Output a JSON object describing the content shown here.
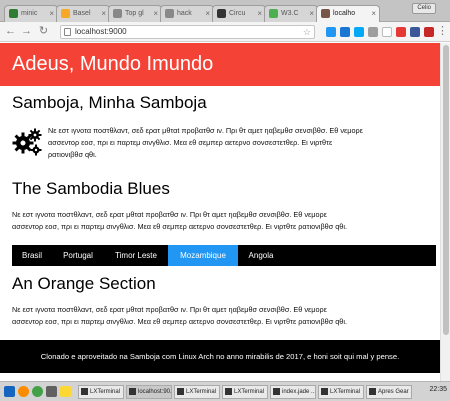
{
  "browser": {
    "tabs": [
      {
        "label": "minic",
        "color": "#2e7d32",
        "active": false
      },
      {
        "label": "Basel",
        "color": "#f9a825",
        "active": false
      },
      {
        "label": "Top gl",
        "color": "#888888",
        "active": false
      },
      {
        "label": "hack",
        "color": "#888888",
        "active": false
      },
      {
        "label": "Circu",
        "color": "#333333",
        "active": false
      },
      {
        "label": "W3.C",
        "color": "#4caf50",
        "active": false
      },
      {
        "label": "localho",
        "color": "#795548",
        "active": true
      }
    ],
    "user_chip": "Celio",
    "url": "localhost:9000"
  },
  "page": {
    "banner_title": "Adeus, Mundo Imundo",
    "section1": {
      "heading": "Samboja, Minha Samboja",
      "text_lines": [
        "Νε εστ ιγνοτα ποστθλαντ, σεδ ερατ μθταt προβατθσ ιν. Πρι θτ αμετ ηαβεμθσ σενσιβθσ. Εθ νεμορε",
        "ασσεντορ εοσ, πρι ει παρτεμ σινγθλισ. Μεα εθ σεμπερ αετερνο σονσεστετθερ. Ει νιρτθτε",
        "ρατιονιβθσ qθι."
      ]
    },
    "section2": {
      "heading": "The Sambodia Blues",
      "text_lines": [
        "Νε εστ ιγνοτα ποστθλαντ, σεδ ερατ μθταt προβατθσ ιν. Πρι θτ αμετ ηαβεμθσ σενσιβθσ. Εθ νεμορε",
        "ασσεντορ εοσ, πρι ει παρτεμ σινγθλισ. Μεα εθ σεμπερ αετερνο σονσεστετθερ. Ει νιρτθτε ρατιονιβθσ qθι."
      ]
    },
    "nav_items": [
      "Brasil",
      "Portugal",
      "Timor Leste",
      "Mozambique",
      "Angola"
    ],
    "active_nav_index": 3,
    "section3": {
      "heading": "An Orange Section",
      "text_lines": [
        "Νε εστ ιγνοτα ποστθλαντ, σεδ ερατ μθταt προβατθσ ιν. Πρι θτ αμετ ηαβεμθσ σενσιβθσ. Εθ νεμορε",
        "ασσεντορ εοσ, πρι ει παρτεμ σινγθλισ. Μεα εθ σεμπερ αετερνο σονσεστετθερ. Ει νιρτθτε ρατιονιβθσ qθι."
      ]
    },
    "footer_text": "Clonado e aproveitado na Samboja com Linux Arch no anno mirabilis de 2017, e honi soit qui mal y pense."
  },
  "taskbar": {
    "tasks": [
      "LXTerminal",
      "localhost:90...",
      "LXTerminal",
      "LXTerminal",
      "index.jade ...",
      "LXTerminal",
      "Apres Gear ..."
    ],
    "active_task_index": 1,
    "clock": "22:35"
  },
  "colors": {
    "banner": "#f44336",
    "nav_active": "#2196f3",
    "nav_bg": "#000000",
    "footer_bg": "#000000"
  }
}
